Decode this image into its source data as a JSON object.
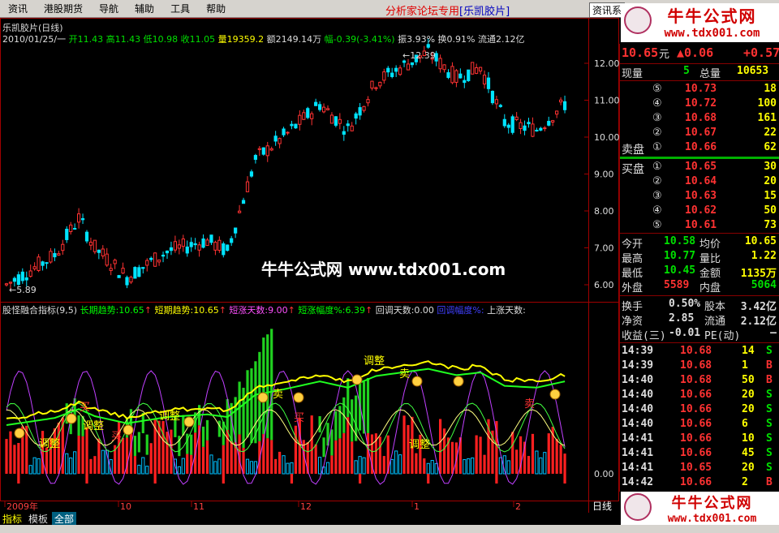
{
  "menu": [
    "资讯",
    "港股期货",
    "导航",
    "辅助",
    "工具",
    "帮助"
  ],
  "title_center": {
    "prefix": "分析家论坛专用",
    "stock": "[乐凯胶片]"
  },
  "info_button": "资讯系",
  "logo": {
    "cn": "牛牛公式网",
    "url": "www.tdx001.com"
  },
  "watermark": "牛牛公式网 www.tdx001.com",
  "chart_header": {
    "name": "乐凯胶片(日线)",
    "date": "2010/01/25/一",
    "open": "开11.43",
    "high": "高11.43",
    "low": "低10.98",
    "close": "收11.05",
    "vol": "量19359.2",
    "amount": "额2149.14万",
    "change": "幅-0.39(-3.41%)",
    "amplitude": "振3.93%",
    "turnover": "换0.91%",
    "float": "流通2.12亿"
  },
  "price_axis": [
    "12.00",
    "11.00",
    "10.00",
    "9.00",
    "8.00",
    "7.00",
    "6.00"
  ],
  "price_marks": {
    "high": "←12.39",
    "low": "←5.89"
  },
  "indicator_header": {
    "name": "股怪融合指标(9,5)",
    "long": "长期趋势:10.65",
    "short": "短期趋势:10.65",
    "days": "短涨天数:9.00",
    "amp": "短涨幅度%:6.39",
    "pull_days": "回调天数:0.00",
    "pull_amp": "回调幅度%:",
    "up_days": "上涨天数:"
  },
  "indicator_axis": "0.00",
  "date_axis": [
    "2009年",
    "10",
    "11",
    "12",
    "1",
    "2"
  ],
  "day_label": "日线",
  "chart_labels": [
    "卖",
    "卖",
    "卖",
    "买",
    "买",
    "买",
    "调整",
    "调整",
    "调整",
    "调整",
    "调整"
  ],
  "bottom_tabs": [
    "指标",
    "模板",
    "全部"
  ],
  "quote": {
    "price": "10.65",
    "unit": "元",
    "change": "▲0.06",
    "change2": "+0.57",
    "now_label": "现量",
    "now_val": "5",
    "total_label": "总量",
    "total_val": "10653",
    "sell_label": "卖盘",
    "buy_label": "买盘",
    "sells": [
      {
        "n": "⑤",
        "p": "10.73",
        "v": "18"
      },
      {
        "n": "④",
        "p": "10.72",
        "v": "100"
      },
      {
        "n": "③",
        "p": "10.68",
        "v": "161"
      },
      {
        "n": "②",
        "p": "10.67",
        "v": "22"
      },
      {
        "n": "①",
        "p": "10.66",
        "v": "62"
      }
    ],
    "buys": [
      {
        "n": "①",
        "p": "10.65",
        "v": "30"
      },
      {
        "n": "②",
        "p": "10.64",
        "v": "20"
      },
      {
        "n": "③",
        "p": "10.63",
        "v": "15"
      },
      {
        "n": "④",
        "p": "10.62",
        "v": "50"
      },
      {
        "n": "⑤",
        "p": "10.61",
        "v": "73"
      }
    ],
    "stats": [
      {
        "l1": "今开",
        "v1": "10.58",
        "l2": "均价",
        "v2": "10.65"
      },
      {
        "l1": "最高",
        "v1": "10.77",
        "l2": "量比",
        "v2": "1.22"
      },
      {
        "l1": "最低",
        "v1": "10.45",
        "l2": "金额",
        "v2": "1135万"
      },
      {
        "l1": "外盘",
        "v1": "5589",
        "l2": "内盘",
        "v2": "5064"
      }
    ],
    "stats2": [
      {
        "l1": "换手",
        "v1": "0.50%",
        "l2": "股本",
        "v2": "3.42亿"
      },
      {
        "l1": "净资",
        "v1": "2.85",
        "l2": "流通",
        "v2": "2.12亿"
      },
      {
        "l1": "收益(三)",
        "v1": "-0.01",
        "l2": "PE(动)",
        "v2": "—"
      }
    ],
    "ticks": [
      {
        "t": "14:39",
        "p": "10.68",
        "v": "14",
        "d": "S"
      },
      {
        "t": "14:39",
        "p": "10.68",
        "v": "1",
        "d": "B"
      },
      {
        "t": "14:40",
        "p": "10.68",
        "v": "50",
        "d": "B"
      },
      {
        "t": "14:40",
        "p": "10.66",
        "v": "20",
        "d": "S"
      },
      {
        "t": "14:40",
        "p": "10.66",
        "v": "20",
        "d": "S"
      },
      {
        "t": "14:40",
        "p": "10.66",
        "v": "6",
        "d": "S"
      },
      {
        "t": "14:41",
        "p": "10.66",
        "v": "10",
        "d": "S"
      },
      {
        "t": "14:41",
        "p": "10.66",
        "v": "45",
        "d": "S"
      },
      {
        "t": "14:41",
        "p": "10.65",
        "v": "20",
        "d": "S"
      },
      {
        "t": "14:42",
        "p": "10.66",
        "v": "2",
        "d": "B"
      }
    ]
  },
  "colors": {
    "up": "#ff3232",
    "down": "#00e4ff",
    "green": "#00ff00",
    "yellow": "#ffff00",
    "red": "#ff3232"
  }
}
